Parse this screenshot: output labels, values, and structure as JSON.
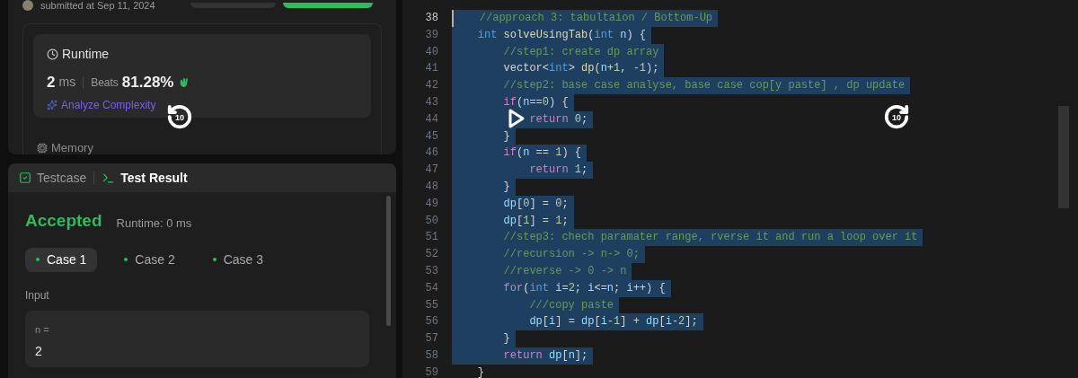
{
  "submission": {
    "submitted": "submitted at Sep 11, 2024"
  },
  "runtime_card": {
    "title": "Runtime",
    "value": "2",
    "unit": "ms",
    "beats_label": "Beats",
    "beats_value": "81.28%",
    "analyze_link": "Analyze Complexity"
  },
  "memory_title": "Memory",
  "bottom_tabs": [
    {
      "label": "Testcase",
      "kind": "testcase",
      "selected": false
    },
    {
      "label": "Test Result",
      "kind": "result",
      "selected": true
    }
  ],
  "result": {
    "status": "Accepted",
    "runtime": "Runtime: 0 ms"
  },
  "cases": [
    {
      "label": "Case 1",
      "selected": true
    },
    {
      "label": "Case 2",
      "selected": false
    },
    {
      "label": "Case 3",
      "selected": false
    }
  ],
  "input": {
    "label": "Input",
    "variable": "n =",
    "value": "2"
  },
  "editor": {
    "lines": [
      {
        "number": "38",
        "cursor": true,
        "selected": true,
        "tokens": [
          {
            "kind": "comment",
            "text": "    //approach 3: tabultaion / Bottom-Up"
          }
        ]
      },
      {
        "number": "39",
        "cursor": false,
        "selected": true,
        "tokens": [
          {
            "kind": "type",
            "text": "    int"
          },
          {
            "kind": "func",
            "text": " solveUsingTab"
          },
          {
            "kind": "plain",
            "text": "("
          },
          {
            "kind": "type",
            "text": "int"
          },
          {
            "kind": "ident",
            "text": " n"
          },
          {
            "kind": "plain",
            "text": ") {"
          }
        ]
      },
      {
        "number": "40",
        "cursor": false,
        "selected": true,
        "tokens": [
          {
            "kind": "comment",
            "text": "        //step1: create dp array"
          }
        ]
      },
      {
        "number": "41",
        "cursor": false,
        "selected": true,
        "tokens": [
          {
            "kind": "plain",
            "text": "        vector<"
          },
          {
            "kind": "type",
            "text": "int"
          },
          {
            "kind": "plain",
            "text": "> "
          },
          {
            "kind": "func",
            "text": "dp"
          },
          {
            "kind": "plain",
            "text": "("
          },
          {
            "kind": "ident",
            "text": "n"
          },
          {
            "kind": "plain",
            "text": "+"
          },
          {
            "kind": "number",
            "text": "1"
          },
          {
            "kind": "plain",
            "text": ", "
          },
          {
            "kind": "number",
            "text": "-1"
          },
          {
            "kind": "plain",
            "text": ");"
          }
        ]
      },
      {
        "number": "42",
        "cursor": false,
        "selected": true,
        "tokens": [
          {
            "kind": "comment",
            "text": "        //step2: base case analyse, base case cop[y paste] , dp update"
          }
        ]
      },
      {
        "number": "43",
        "cursor": false,
        "selected": true,
        "tokens": [
          {
            "kind": "keyword",
            "text": "        if"
          },
          {
            "kind": "plain",
            "text": "("
          },
          {
            "kind": "ident",
            "text": "n"
          },
          {
            "kind": "plain",
            "text": "=="
          },
          {
            "kind": "number",
            "text": "0"
          },
          {
            "kind": "plain",
            "text": ") {"
          }
        ]
      },
      {
        "number": "44",
        "cursor": false,
        "selected": true,
        "tokens": [
          {
            "kind": "keyword",
            "text": "            return"
          },
          {
            "kind": "number",
            "text": " 0"
          },
          {
            "kind": "plain",
            "text": ";"
          }
        ]
      },
      {
        "number": "45",
        "cursor": false,
        "selected": true,
        "tokens": [
          {
            "kind": "plain",
            "text": "        }"
          }
        ]
      },
      {
        "number": "46",
        "cursor": false,
        "selected": true,
        "tokens": [
          {
            "kind": "keyword",
            "text": "        if"
          },
          {
            "kind": "plain",
            "text": "("
          },
          {
            "kind": "ident",
            "text": "n"
          },
          {
            "kind": "plain",
            "text": " == "
          },
          {
            "kind": "number",
            "text": "1"
          },
          {
            "kind": "plain",
            "text": ") {"
          }
        ]
      },
      {
        "number": "47",
        "cursor": false,
        "selected": true,
        "tokens": [
          {
            "kind": "keyword",
            "text": "            return"
          },
          {
            "kind": "number",
            "text": " 1"
          },
          {
            "kind": "plain",
            "text": ";"
          }
        ]
      },
      {
        "number": "48",
        "cursor": false,
        "selected": true,
        "tokens": [
          {
            "kind": "plain",
            "text": "        }"
          }
        ]
      },
      {
        "number": "49",
        "cursor": false,
        "selected": true,
        "tokens": [
          {
            "kind": "ident",
            "text": "        dp"
          },
          {
            "kind": "plain",
            "text": "["
          },
          {
            "kind": "number",
            "text": "0"
          },
          {
            "kind": "plain",
            "text": "] = "
          },
          {
            "kind": "number",
            "text": "0"
          },
          {
            "kind": "plain",
            "text": ";"
          }
        ]
      },
      {
        "number": "50",
        "cursor": false,
        "selected": true,
        "tokens": [
          {
            "kind": "ident",
            "text": "        dp"
          },
          {
            "kind": "plain",
            "text": "["
          },
          {
            "kind": "number",
            "text": "1"
          },
          {
            "kind": "plain",
            "text": "] = "
          },
          {
            "kind": "number",
            "text": "1"
          },
          {
            "kind": "plain",
            "text": ";"
          }
        ]
      },
      {
        "number": "51",
        "cursor": false,
        "selected": true,
        "tokens": [
          {
            "kind": "comment",
            "text": "        //step3: chech paramater range, rverse it and run a loop over it"
          }
        ]
      },
      {
        "number": "52",
        "cursor": false,
        "selected": true,
        "tokens": [
          {
            "kind": "comment",
            "text": "        //recursion -> n-> 0;"
          }
        ]
      },
      {
        "number": "53",
        "cursor": false,
        "selected": true,
        "tokens": [
          {
            "kind": "comment",
            "text": "        //reverse -> 0 -> n"
          }
        ]
      },
      {
        "number": "54",
        "cursor": false,
        "selected": true,
        "tokens": [
          {
            "kind": "keyword",
            "text": "        for"
          },
          {
            "kind": "plain",
            "text": "("
          },
          {
            "kind": "type",
            "text": "int"
          },
          {
            "kind": "ident",
            "text": " i"
          },
          {
            "kind": "plain",
            "text": "="
          },
          {
            "kind": "number",
            "text": "2"
          },
          {
            "kind": "plain",
            "text": "; "
          },
          {
            "kind": "ident",
            "text": "i"
          },
          {
            "kind": "plain",
            "text": "<="
          },
          {
            "kind": "ident",
            "text": "n"
          },
          {
            "kind": "plain",
            "text": "; "
          },
          {
            "kind": "ident",
            "text": "i"
          },
          {
            "kind": "plain",
            "text": "++) {"
          }
        ]
      },
      {
        "number": "55",
        "cursor": false,
        "selected": true,
        "tokens": [
          {
            "kind": "comment",
            "text": "            ///copy paste"
          }
        ]
      },
      {
        "number": "56",
        "cursor": false,
        "selected": true,
        "tokens": [
          {
            "kind": "ident",
            "text": "            dp"
          },
          {
            "kind": "plain",
            "text": "["
          },
          {
            "kind": "ident",
            "text": "i"
          },
          {
            "kind": "plain",
            "text": "] = "
          },
          {
            "kind": "ident",
            "text": "dp"
          },
          {
            "kind": "plain",
            "text": "["
          },
          {
            "kind": "ident",
            "text": "i"
          },
          {
            "kind": "plain",
            "text": "-"
          },
          {
            "kind": "number",
            "text": "1"
          },
          {
            "kind": "plain",
            "text": "] + "
          },
          {
            "kind": "ident",
            "text": "dp"
          },
          {
            "kind": "plain",
            "text": "["
          },
          {
            "kind": "ident",
            "text": "i"
          },
          {
            "kind": "plain",
            "text": "-"
          },
          {
            "kind": "number",
            "text": "2"
          },
          {
            "kind": "plain",
            "text": "];"
          }
        ]
      },
      {
        "number": "57",
        "cursor": false,
        "selected": true,
        "tokens": [
          {
            "kind": "plain",
            "text": "        }"
          }
        ]
      },
      {
        "number": "58",
        "cursor": false,
        "selected": true,
        "tokens": [
          {
            "kind": "keyword",
            "text": "        return"
          },
          {
            "kind": "ident",
            "text": " dp"
          },
          {
            "kind": "plain",
            "text": "["
          },
          {
            "kind": "ident",
            "text": "n"
          },
          {
            "kind": "plain",
            "text": "];"
          }
        ]
      },
      {
        "number": "59",
        "cursor": false,
        "selected": false,
        "tokens": [
          {
            "kind": "plain",
            "text": "    }"
          }
        ]
      }
    ]
  },
  "video_overlay": {
    "rewind_label": "10",
    "forward_label": "10"
  }
}
